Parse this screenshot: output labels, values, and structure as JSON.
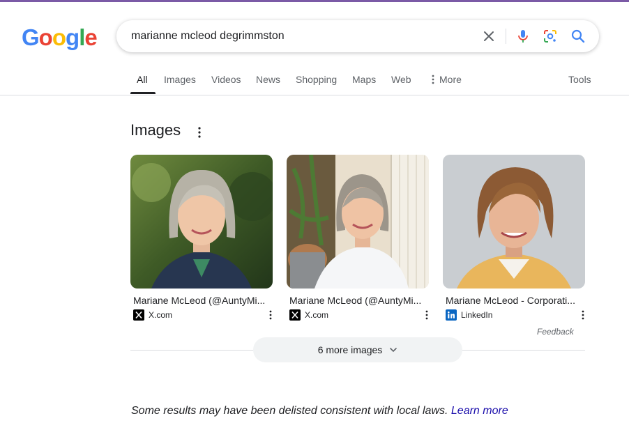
{
  "colors": {
    "accent_bar": "#7b5aa6",
    "link": "#1a0dab",
    "mic_blue": "#4285f4",
    "mic_red": "#ea4335",
    "lens_yellow": "#fbbc05",
    "lens_green": "#34a853"
  },
  "logo": {
    "letters": [
      "G",
      "o",
      "o",
      "g",
      "l",
      "e"
    ],
    "letter_colors": [
      "#4285f4",
      "#ea4335",
      "#fbbc05",
      "#4285f4",
      "#34a853",
      "#ea4335"
    ]
  },
  "search": {
    "value": "marianne mcleod degrimmston",
    "icons": [
      "clear-icon",
      "microphone-icon",
      "lens-icon",
      "search-icon"
    ]
  },
  "tabs": [
    {
      "label": "All",
      "active": true
    },
    {
      "label": "Images"
    },
    {
      "label": "Videos"
    },
    {
      "label": "News"
    },
    {
      "label": "Shopping"
    },
    {
      "label": "Maps"
    },
    {
      "label": "Web"
    },
    {
      "label": "More",
      "icon": "vertical-dots-icon"
    }
  ],
  "tools_label": "Tools",
  "images_section": {
    "title": "Images",
    "cards": [
      {
        "title": "Mariane McLeod (@AuntyMi...",
        "source": "X.com",
        "source_icon": "x-logo-icon"
      },
      {
        "title": "Mariane McLeod (@AuntyMi...",
        "source": "X.com",
        "source_icon": "x-logo-icon"
      },
      {
        "title": "Mariane McLeod - Corporati...",
        "source": "LinkedIn",
        "source_icon": "linkedin-logo-icon"
      }
    ],
    "feedback": "Feedback",
    "more_button": "6 more images"
  },
  "footer_notice": {
    "text": "Some results may have been delisted consistent with local laws.",
    "link": "Learn more"
  }
}
